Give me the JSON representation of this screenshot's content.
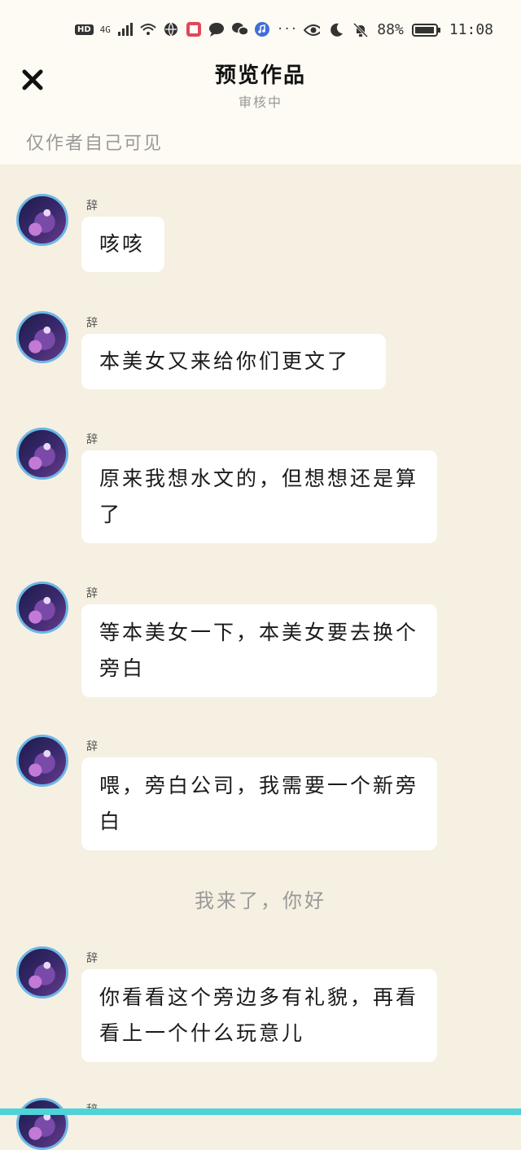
{
  "statusbar": {
    "network": "4G",
    "hd": "HD",
    "battery": "88%",
    "time": "11:08",
    "more": "···"
  },
  "header": {
    "title": "预览作品",
    "subtitle": "审核中",
    "visibility": "仅作者自己可见"
  },
  "messages": [
    {
      "name": "辞",
      "text": "咳咳"
    },
    {
      "name": "辞",
      "text": "本美女又来给你们更文了"
    },
    {
      "name": "辞",
      "text": "原来我想水文的，但想想还是算了"
    },
    {
      "name": "辞",
      "text": "等本美女一下，本美女要去换个旁白"
    },
    {
      "name": "辞",
      "text": "喂，旁白公司，我需要一个新旁白"
    },
    {
      "name": "辞",
      "text": "你看看这个旁边多有礼貌，再看看上一个什么玩意儿"
    },
    {
      "name": "辞",
      "text": ""
    }
  ],
  "narration": "我来了，你好",
  "colors": {
    "background": "#f5f0e1",
    "header": "#fdfbf3",
    "bubble": "#ffffff",
    "avatar_border": "#6cb6e8",
    "bottom_bar": "#4fd2d8"
  }
}
